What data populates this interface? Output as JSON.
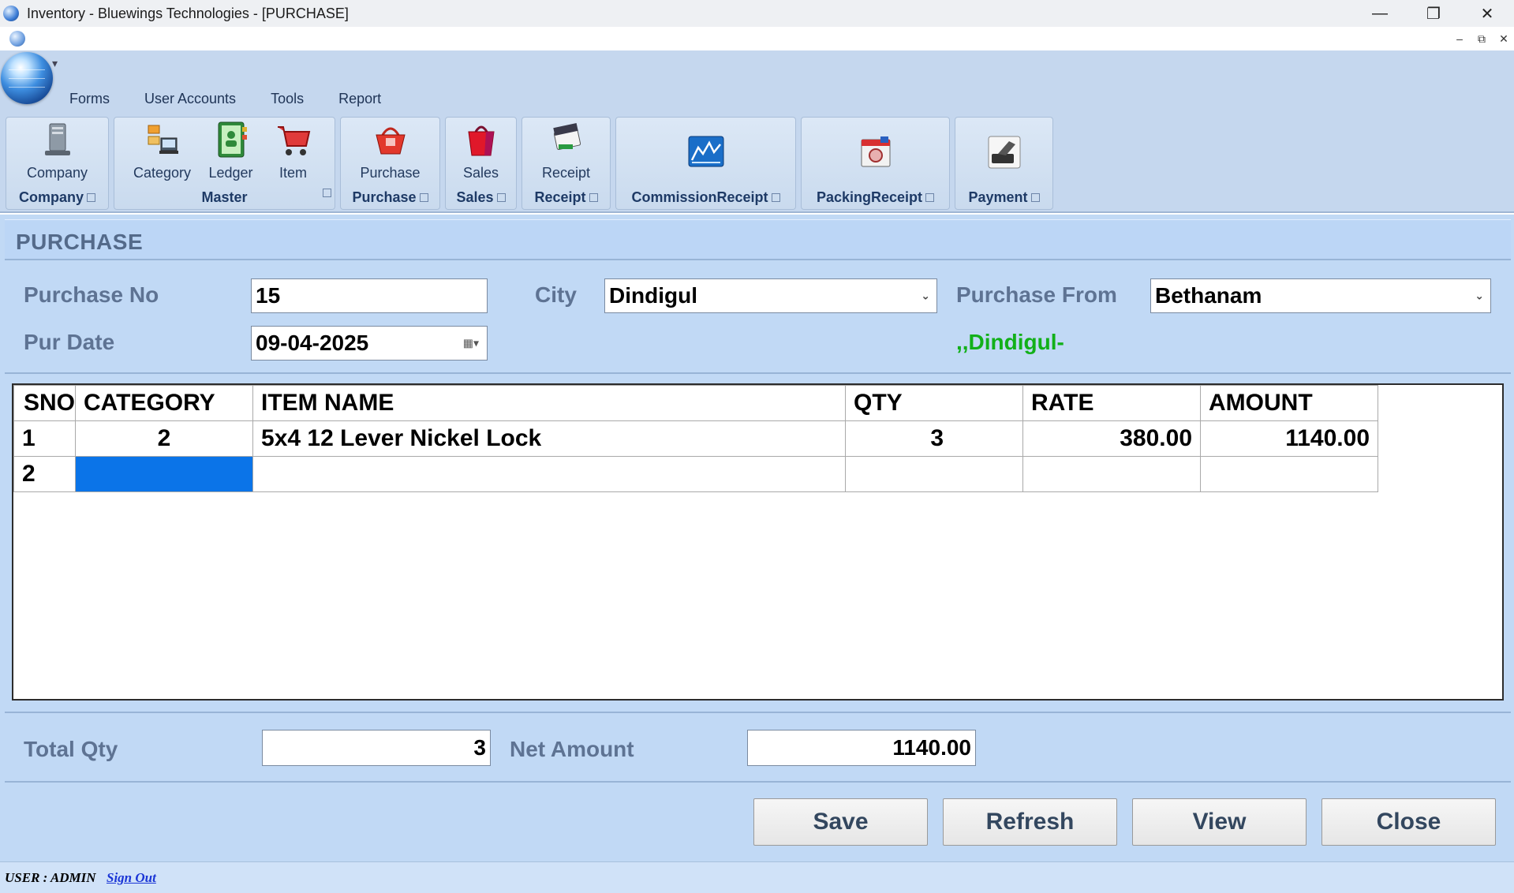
{
  "window": {
    "title": "Inventory - Bluewings Technologies - [PURCHASE]"
  },
  "menu": {
    "tabs": [
      "Forms",
      "User Accounts",
      "Tools",
      "Report"
    ]
  },
  "ribbon": {
    "groups": [
      {
        "label": "Company",
        "items": [
          {
            "label": "Company",
            "icon": "server-icon"
          }
        ]
      },
      {
        "label": "Master",
        "items": [
          {
            "label": "Category",
            "icon": "category-icon"
          },
          {
            "label": "Ledger",
            "icon": "ledger-book-icon"
          },
          {
            "label": "Item",
            "icon": "cart-icon"
          }
        ]
      },
      {
        "label": "Purchase",
        "items": [
          {
            "label": "Purchase",
            "icon": "shopping-basket-icon"
          }
        ]
      },
      {
        "label": "Sales",
        "items": [
          {
            "label": "Sales",
            "icon": "shopping-bag-icon"
          }
        ]
      },
      {
        "label": "Receipt",
        "items": [
          {
            "label": "Receipt",
            "icon": "receipt-icon"
          }
        ]
      },
      {
        "label": "CommissionReceipt",
        "items": [
          {
            "label": "",
            "icon": "chart-icon"
          }
        ]
      },
      {
        "label": "PackingReceipt",
        "items": [
          {
            "label": "",
            "icon": "packing-icon"
          }
        ]
      },
      {
        "label": "Payment",
        "items": [
          {
            "label": "",
            "icon": "payment-icon"
          }
        ]
      }
    ]
  },
  "form": {
    "title": "PURCHASE",
    "fields": {
      "purchase_no_label": "Purchase No",
      "purchase_no": "15",
      "city_label": "City",
      "city": "Dindigul",
      "purchase_from_label": "Purchase From",
      "purchase_from": "Bethanam",
      "pur_date_label": "Pur Date",
      "pur_date": "09-04-2025",
      "supplier_address": ",,Dindigul-"
    },
    "grid": {
      "columns": [
        "SNO",
        "CATEGORY",
        "ITEM NAME",
        "QTY",
        "RATE",
        "AMOUNT"
      ],
      "rows": [
        [
          "1",
          "2",
          "5x4 12 Lever Nickel Lock",
          "3",
          "380.00",
          "1140.00"
        ],
        [
          "2",
          "",
          "",
          "",
          "",
          ""
        ]
      ]
    },
    "totals": {
      "total_qty_label": "Total Qty",
      "total_qty": "3",
      "net_amount_label": "Net Amount",
      "net_amount": "1140.00"
    },
    "buttons": {
      "save": "Save",
      "refresh": "Refresh",
      "view": "View",
      "close": "Close"
    }
  },
  "status": {
    "user_text": "USER :  ADMIN",
    "signout": "Sign Out"
  }
}
